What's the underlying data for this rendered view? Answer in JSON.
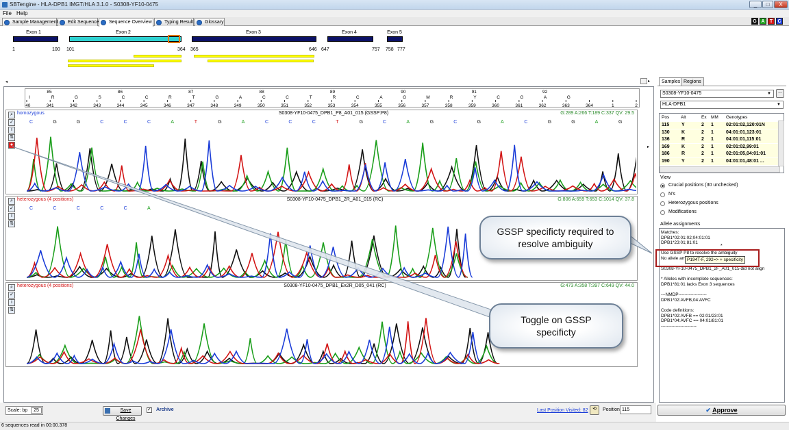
{
  "window": {
    "title": "SBTengine - HLA-DPB1 IMGT/HLA 3.1.0 - S0308-YF10-0475",
    "minimize": "_",
    "maximize": "□",
    "close": "X"
  },
  "menu": {
    "file": "File",
    "help": "Help"
  },
  "tabs": [
    {
      "label": "Sample Management"
    },
    {
      "label": "Edit Sequence"
    },
    {
      "label": "Sequence Overview"
    },
    {
      "label": "Typing Result"
    },
    {
      "label": "Glossary"
    }
  ],
  "gatc": {
    "g": "G",
    "a": "A",
    "t": "T",
    "c": "C",
    "colors": [
      "#111111",
      "#1a9e1a",
      "#d21414",
      "#1a3cd8"
    ]
  },
  "exons": [
    {
      "label": "Exon 1",
      "start": "1",
      "end": "100"
    },
    {
      "label": "Exon 2",
      "start": "101",
      "end": "364"
    },
    {
      "label": "Exon 3",
      "start": "365",
      "end": "646"
    },
    {
      "label": "Exon 4",
      "start": "647",
      "end": "757"
    },
    {
      "label": "Exon 5",
      "start": "758",
      "end": "777"
    }
  ],
  "ruler": {
    "codons": [
      "85",
      "86",
      "87",
      "88",
      "89",
      "90",
      "91",
      "92"
    ],
    "consensus": [
      "I",
      "R",
      "G",
      "S",
      "C",
      "C",
      "R",
      "T",
      "G",
      "A",
      "C",
      "C",
      "T",
      "R",
      "C",
      "A",
      "G",
      "M",
      "R",
      "Y",
      "C",
      "G",
      "A",
      "G"
    ],
    "positions": [
      "340",
      "341",
      "342",
      "343",
      "344",
      "345",
      "346",
      "347",
      "348",
      "349",
      "350",
      "351",
      "352",
      "353",
      "354",
      "355",
      "356",
      "357",
      "358",
      "359",
      "360",
      "361",
      "362",
      "363",
      "364",
      "1",
      "2"
    ]
  },
  "traces": [
    {
      "status": "homozygous",
      "name": "S0308-YF10-0475_DPB1_P8_A01_015 (GSSP:P8)",
      "qv": "G:289 A:266 T:189 C:337 QV: 29.5",
      "calls": [
        "C",
        "G",
        "G",
        "C",
        "C",
        "C",
        "A",
        "T",
        "G",
        "A",
        "C",
        "C",
        "C",
        "T",
        "G",
        "C",
        "A",
        "G",
        "C",
        "G",
        "A",
        "C",
        "G",
        "G",
        "A",
        "G"
      ]
    },
    {
      "status": "heterozygous (4 positions)",
      "name": "S0308-YF10-0475_DPB1_2R_A01_015 (RC)",
      "qv": "G:806 A:659 T:653 C:1014 QV: 37.8",
      "calls": [
        "C",
        "C",
        "C",
        "C",
        "C",
        "A"
      ]
    },
    {
      "status": "heterozygous (4 positions)",
      "name": "S0308-YF10-0475_DPB1_Ex2R_D05_041 (RC)",
      "qv": "G:473 A:358 T:397 C:649 QV: 44.0",
      "calls": []
    }
  ],
  "right": {
    "tabs": {
      "samples": "Samples",
      "regions": "Regions"
    },
    "sample": "S0308-YF10-0475",
    "locus": "HLA-DPB1",
    "browse": "...",
    "table_headers": {
      "pos": "Pos",
      "alt": "Alt",
      "ex": "Ex",
      "mm": "MM",
      "genotypes": "Genotypes"
    },
    "rows": [
      {
        "pos": "115",
        "alt": "Y",
        "ex": "2",
        "mm": "1",
        "g": "02:01:02,120:01N"
      },
      {
        "pos": "130",
        "alt": "K",
        "ex": "2",
        "mm": "1",
        "g": "04:01:01,123:01"
      },
      {
        "pos": "136",
        "alt": "R",
        "ex": "2",
        "mm": "1",
        "g": "04:01:01,115:01"
      },
      {
        "pos": "169",
        "alt": "K",
        "ex": "2",
        "mm": "1",
        "g": "02:01:02,99:01"
      },
      {
        "pos": "186",
        "alt": "R",
        "ex": "2",
        "mm": "1",
        "g": "02:01:05,04:01:01"
      },
      {
        "pos": "190",
        "alt": "Y",
        "ex": "2",
        "mm": "1",
        "g": "04:01:01,48:01 ..."
      }
    ],
    "view_label": "View",
    "view_options": [
      "Crucial positions (30 unchecked)",
      "N's",
      "Heterozygous positions",
      "Modifications"
    ],
    "allele_label": "Allele assignments",
    "allele_lines": [
      "Matches:",
      "DPB1*02:01:02;04:01:01",
      "DPB1*23:01;81:01",
      "",
      "Use GSSP P8 to resolve the ambiguity",
      "No allele ambiguities",
      "",
      "S0308-YF10-0475_DPB1_2F_A01_015 did not align",
      "",
      "* Alleles with incomplete sequences:",
      "DPB1*81:01 lacks Exon 3 sequences",
      "",
      "---NMDP-------------------",
      "DPB1*02:AVFB,04:AVFC",
      "",
      "Code definitions:",
      "DPB1*02:AVFB == 02:01/23:01",
      "DPB1*04:AVFC == 04:01/81:01",
      "------------------------"
    ],
    "tooltip": "P194T-F, 292=> + specificity",
    "approve": "Approve"
  },
  "callouts": {
    "c1": "GSSP specificty required to resolve ambiguity",
    "c2": "Toggle on GSSP specificty"
  },
  "bottom": {
    "scale_label": "Scale: bp",
    "scale_value": "25",
    "save": "Save Changes",
    "archive": "Archive",
    "last_visited": "Last Position Visited: 82",
    "position_label": "Position",
    "position_value": "115"
  },
  "status": "6 sequences read in 00:00.378"
}
